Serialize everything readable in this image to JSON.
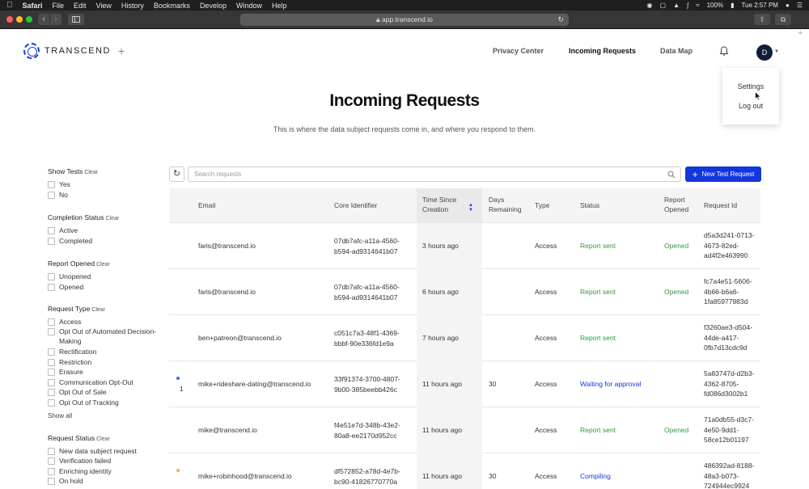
{
  "menubar": {
    "app": "Safari",
    "items": [
      "File",
      "Edit",
      "View",
      "History",
      "Bookmarks",
      "Develop",
      "Window",
      "Help"
    ],
    "battery": "100%",
    "clock": "Tue 2:57 PM"
  },
  "browser": {
    "url": "app.transcend.io"
  },
  "header": {
    "logo_text": "TRANSCEND",
    "logo_plus": "+",
    "nav": {
      "privacy_center": "Privacy Center",
      "incoming_requests": "Incoming Requests",
      "data_map": "Data Map"
    },
    "avatar_initial": "D"
  },
  "user_menu": {
    "settings": "Settings",
    "logout": "Log out"
  },
  "page": {
    "title": "Incoming Requests",
    "subtitle": "This is where the data subject requests come in, and where you respond to them."
  },
  "filters": {
    "clear_label": "Clear",
    "show_all": "Show all",
    "groups": [
      {
        "title": "Show Tests",
        "options": [
          "Yes",
          "No"
        ]
      },
      {
        "title": "Completion Status",
        "options": [
          "Active",
          "Completed"
        ]
      },
      {
        "title": "Report Opened",
        "options": [
          "Unopened",
          "Opened"
        ]
      },
      {
        "title": "Request Type",
        "options": [
          "Access",
          "Opt Out of Automated Decision-Making",
          "Rectification",
          "Restriction",
          "Erasure",
          "Communication Opt-Out",
          "Opt Out of Sale",
          "Opt Out of Tracking"
        ]
      },
      {
        "title": "Request Status",
        "options": [
          "New data subject request",
          "Verification failed",
          "Enriching identity",
          "On hold"
        ]
      }
    ]
  },
  "search": {
    "placeholder": "Search requests"
  },
  "new_request_button": "New Test Request",
  "table": {
    "headers": {
      "email": "Email",
      "core_identifier": "Core Identifier",
      "time_since_creation": [
        "Time Since",
        "Creation"
      ],
      "days_remaining": [
        "Days",
        "Remaining"
      ],
      "type": "Type",
      "status": "Status",
      "report_opened": [
        "Report",
        "Opened"
      ],
      "request_id": "Request Id"
    },
    "rows": [
      {
        "indicator": "",
        "email": "faris@transcend.io",
        "core_id": [
          "07db7afc-a11a-4560-",
          "b594-ad9314641b07"
        ],
        "time": "3 hours ago",
        "days": "",
        "type": "Access",
        "status": "Report sent",
        "opened": "Opened",
        "request_id": [
          "d5a3d241-0713-",
          "4673-82ed-",
          "ad4f2e463990"
        ]
      },
      {
        "indicator": "",
        "email": "faris@transcend.io",
        "core_id": [
          "07db7afc-a11a-4560-",
          "b594-ad9314641b07"
        ],
        "time": "6 hours ago",
        "days": "",
        "type": "Access",
        "status": "Report sent",
        "opened": "Opened",
        "request_id": [
          "fc7a4e51-5606-",
          "4b66-b6a6-",
          "1fa85977983d"
        ]
      },
      {
        "indicator": "",
        "email": "ben+patreon@transcend.io",
        "core_id": [
          "c051c7a3-48f1-4369-",
          "bbbf-90e336fd1e9a"
        ],
        "time": "7 hours ago",
        "days": "",
        "type": "Access",
        "status": "Report sent",
        "opened": "",
        "request_id": [
          "f3260ae3-d504-",
          "44de-a417-",
          "0fb7d13cdc9d"
        ]
      },
      {
        "indicator": "1",
        "email": "mike+rideshare-dating@transcend.io",
        "core_id": [
          "33f91374-3700-4807-",
          "9b00-385beebb426c"
        ],
        "time": "11 hours ago",
        "days": "30",
        "type": "Access",
        "status": "Waiting for approval",
        "opened": "",
        "request_id": [
          "5a83747d-d2b3-",
          "4362-8705-",
          "fd086d3002b1"
        ]
      },
      {
        "indicator": "",
        "email": "mike@transcend.io",
        "core_id": [
          "f4e51e7d-348b-43e2-",
          "80a8-ee2170d952cc"
        ],
        "time": "11 hours ago",
        "days": "",
        "type": "Access",
        "status": "Report sent",
        "opened": "Opened",
        "request_id": [
          "71a0db55-d3c7-",
          "4e50-9dd1-",
          "58ce12b01197"
        ]
      },
      {
        "indicator": "",
        "email": "mike+robinhood@transcend.io",
        "core_id": [
          "df572852-a78d-4e7b-",
          "bc90-41826770770a"
        ],
        "time": "11 hours ago",
        "days": "30",
        "type": "Access",
        "status": "Compiling",
        "opened": "",
        "request_id": [
          "486392ad-8188-",
          "48a3-b073-",
          "724944ec9924"
        ]
      }
    ]
  },
  "colors": {
    "brand_blue": "#1236e0",
    "status_green": "#2e9c3a",
    "dot_blue": "#3b6fd8",
    "dot_yellow": "#e8b92e"
  }
}
